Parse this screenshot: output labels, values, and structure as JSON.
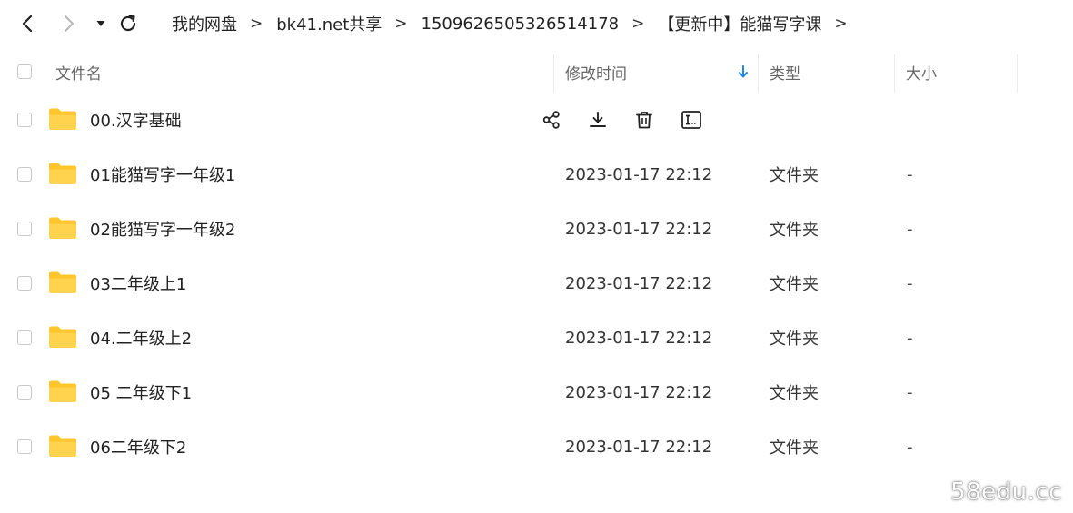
{
  "nav": {
    "back": "back-icon",
    "forward": "forward-icon",
    "dropdown": "dropdown-icon",
    "refresh": "refresh-icon"
  },
  "breadcrumb": {
    "items": [
      "我的网盘",
      "bk41.net共享",
      "1509626505326514178",
      "【更新中】能猫写字课"
    ],
    "separator": ">"
  },
  "table": {
    "columns": {
      "name": "文件名",
      "modified": "修改时间",
      "type": "类型",
      "size": "大小"
    },
    "sort": {
      "column": "modified",
      "direction": "desc",
      "icon": "arrow-down-icon"
    },
    "hover_actions": [
      "share-icon",
      "download-icon",
      "delete-icon",
      "rename-icon"
    ],
    "rows": [
      {
        "name": "00.汉字基础",
        "modified": "",
        "type": "",
        "size": ""
      },
      {
        "name": "01能猫写字一年级1",
        "modified": "2023-01-17 22:12",
        "type": "文件夹",
        "size": "-"
      },
      {
        "name": "02能猫写字一年级2",
        "modified": "2023-01-17 22:12",
        "type": "文件夹",
        "size": "-"
      },
      {
        "name": "03二年级上1",
        "modified": "2023-01-17 22:12",
        "type": "文件夹",
        "size": "-"
      },
      {
        "name": "04.二年级上2",
        "modified": "2023-01-17 22:12",
        "type": "文件夹",
        "size": "-"
      },
      {
        "name": "05 二年级下1",
        "modified": "2023-01-17 22:12",
        "type": "文件夹",
        "size": "-"
      },
      {
        "name": "06二年级下2",
        "modified": "2023-01-17 22:12",
        "type": "文件夹",
        "size": "-"
      }
    ]
  },
  "colors": {
    "folder": "#FFC72C",
    "sort_arrow": "#1E88E5",
    "divider": "#ececec"
  },
  "watermark": "58edu.cc"
}
